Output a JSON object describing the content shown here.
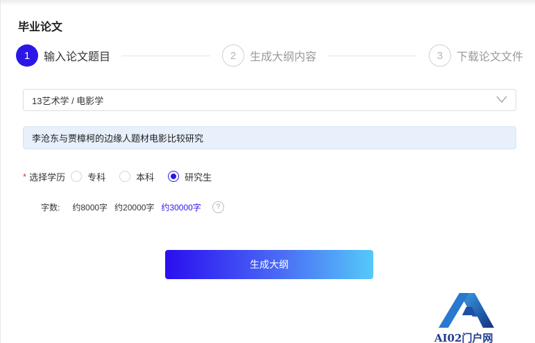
{
  "page": {
    "title": "毕业论文"
  },
  "steps": [
    {
      "number": "1",
      "label": "输入论文题目",
      "state": "active"
    },
    {
      "number": "2",
      "label": "生成大纲内容",
      "state": "inactive"
    },
    {
      "number": "3",
      "label": "下载论文文件",
      "state": "inactive"
    }
  ],
  "subject_select": {
    "value": "13艺术学 / 电影学",
    "icon": "chevron-down-icon"
  },
  "topic_input": {
    "value": "李沧东与贾樟柯的边缘人题材电影比较研究"
  },
  "education": {
    "required_mark": "*",
    "label": "选择学历",
    "options": [
      {
        "label": "专科",
        "checked": false
      },
      {
        "label": "本科",
        "checked": false
      },
      {
        "label": "研究生",
        "checked": true
      }
    ]
  },
  "word_count": {
    "label": "字数:",
    "options": [
      {
        "label": "约8000字",
        "selected": false
      },
      {
        "label": "约20000字",
        "selected": false
      },
      {
        "label": "约30000字",
        "selected": true
      }
    ],
    "help_icon": "?"
  },
  "generate_button": {
    "label": "生成大纲"
  },
  "watermark": {
    "text": "AI02门户网"
  },
  "colors": {
    "accent": "#2b16e8",
    "input_bg": "#e8f0fc",
    "required": "#e0302a"
  }
}
